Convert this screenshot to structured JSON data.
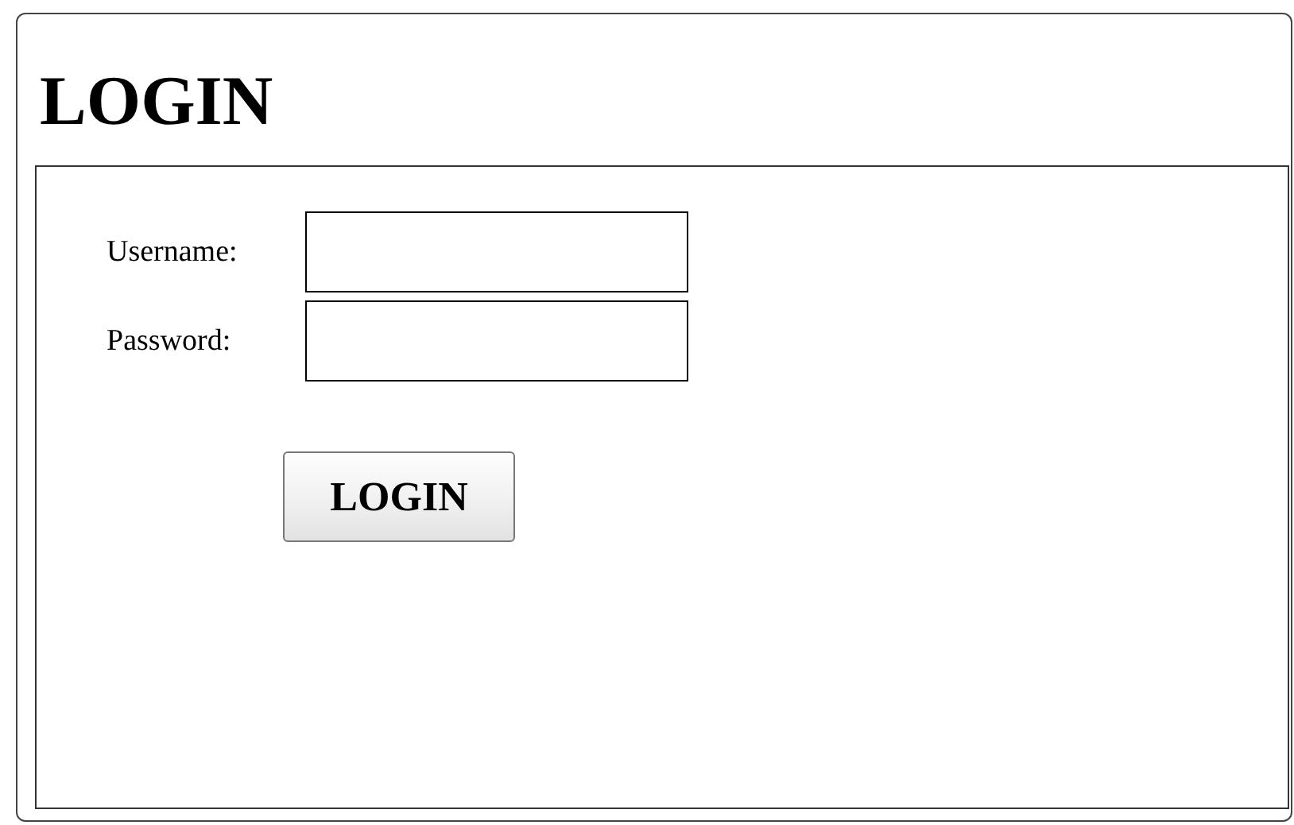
{
  "title": "LOGIN",
  "fields": [
    {
      "label": "Username:"
    },
    {
      "label": "Password:"
    }
  ],
  "button": "LOGIN"
}
